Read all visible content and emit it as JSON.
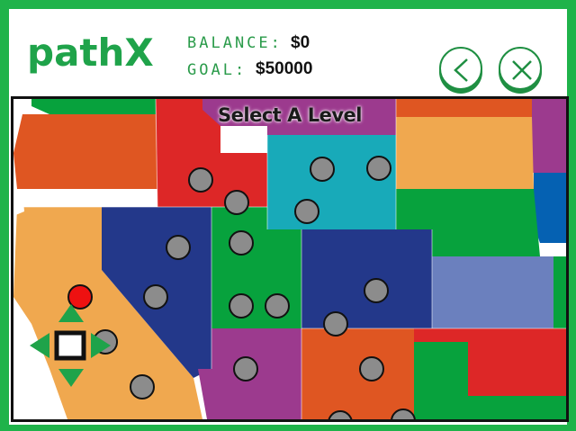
{
  "header": {
    "logo": "pathX",
    "balance_label": "BALANCE:",
    "balance_value": "$0",
    "goal_label": "GOAL:",
    "goal_value": "$50000"
  },
  "buttons": {
    "back_icon": "chevron-left-icon",
    "close_icon": "close-icon"
  },
  "map": {
    "title": "Select A Level",
    "nav_icon": "pan-arrows-icon",
    "state_colors": [
      "#df5622",
      "#dd2727",
      "#9c3a8e",
      "#18aab9",
      "#f0a84f",
      "#07a23d",
      "#23388a",
      "#6b80be",
      "#0561b2"
    ],
    "level_markers": {
      "locked_color": "#8c8c8c",
      "available_color": "#ee1111",
      "count": 22,
      "available_count": 1
    }
  },
  "colors": {
    "frame_green": "#1fb34a",
    "logo_green": "#1fa34a"
  }
}
